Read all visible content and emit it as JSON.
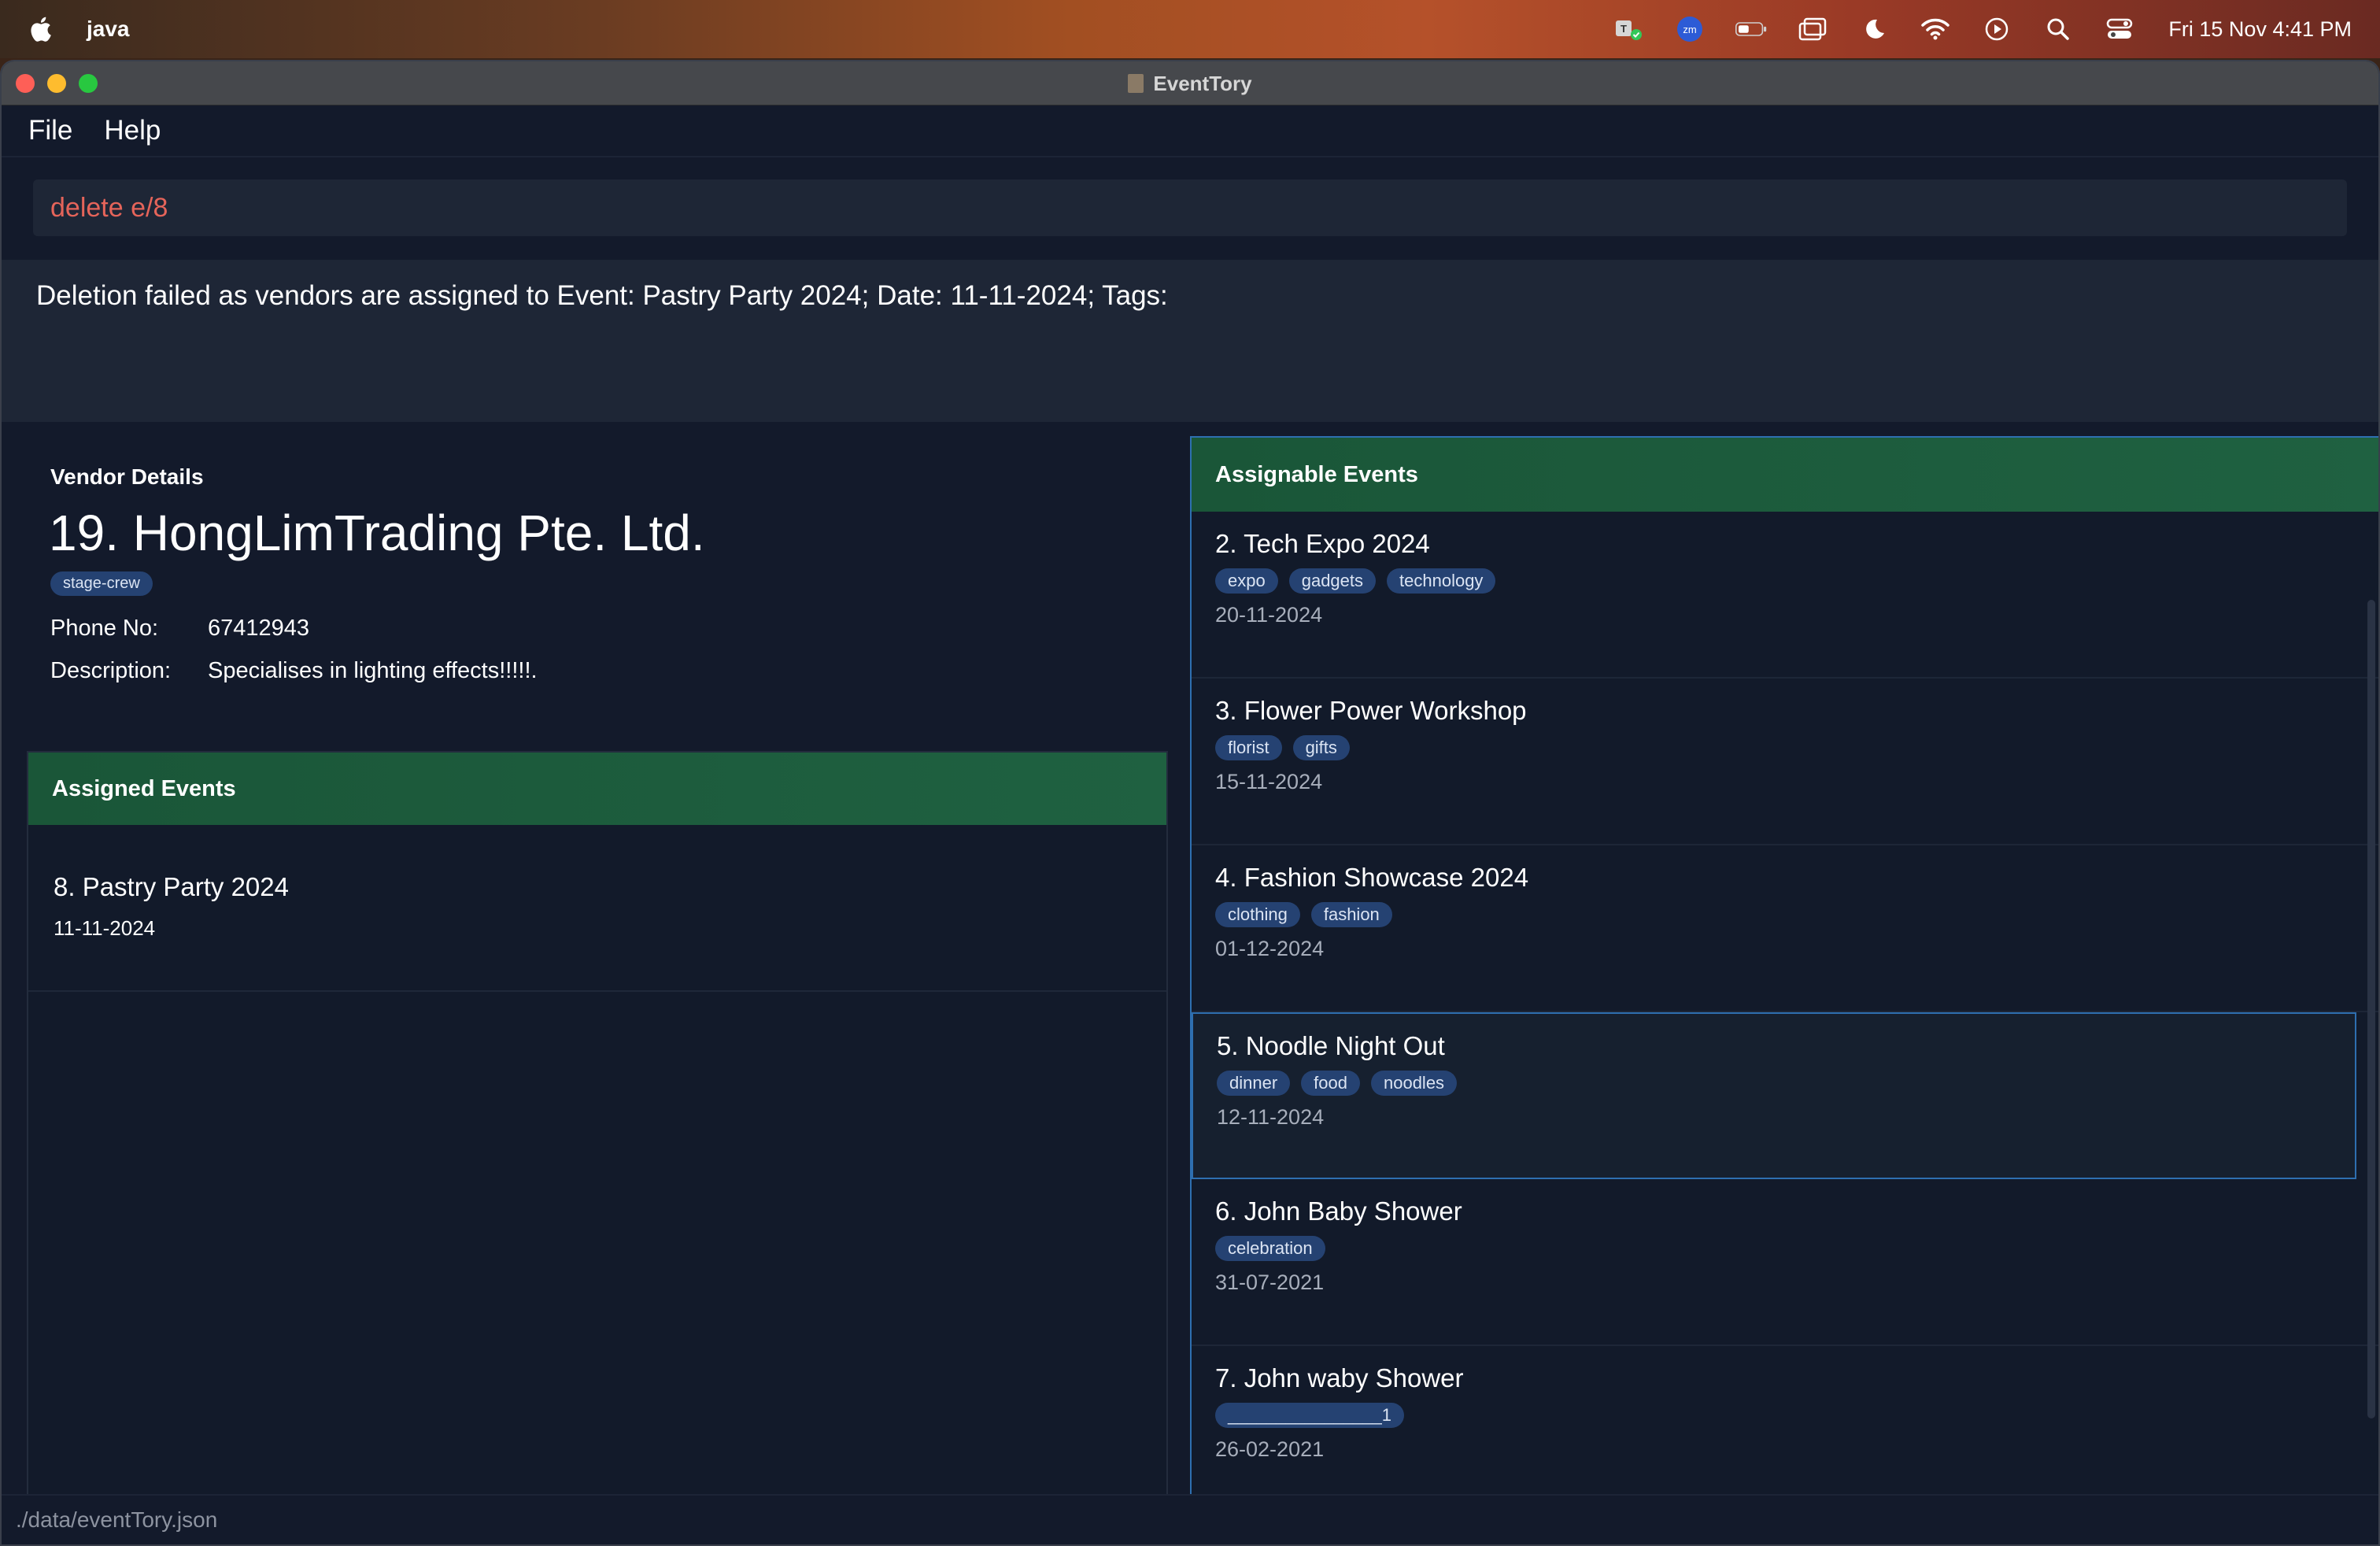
{
  "menubar": {
    "app_name": "java",
    "icons": [
      "apple-icon",
      "teams-icon",
      "zoom-icon",
      "battery-icon",
      "stage-manager-icon",
      "focus-moon-icon",
      "wifi-icon",
      "play-icon",
      "search-icon",
      "control-center-icon"
    ],
    "zoom_label": "zm",
    "clock": "Fri 15 Nov  4:41 PM"
  },
  "window": {
    "title": "EventTory"
  },
  "menu": {
    "file": "File",
    "help": "Help"
  },
  "command": {
    "value": "delete e/8"
  },
  "result": {
    "message": "Deletion failed as vendors are assigned to Event: Pastry Party 2024; Date: 11-11-2024; Tags:"
  },
  "vendor": {
    "section_label": "Vendor Details",
    "name": "19. HongLimTrading Pte. Ltd.",
    "tag": "stage-crew",
    "phone_label": "Phone No:",
    "phone": "67412943",
    "description_label": "Description:",
    "description": "Specialises in lighting effects!!!!!."
  },
  "assigned_events": {
    "header": "Assigned Events",
    "items": [
      {
        "title": "8. Pastry Party 2024",
        "date": "11-11-2024"
      }
    ]
  },
  "assignable_events": {
    "header": "Assignable Events",
    "items": [
      {
        "title": "2. Tech Expo 2024",
        "tags": [
          "expo",
          "gadgets",
          "technology"
        ],
        "date": "20-11-2024"
      },
      {
        "title": "3. Flower Power Workshop",
        "tags": [
          "florist",
          "gifts"
        ],
        "date": "15-11-2024"
      },
      {
        "title": "4. Fashion Showcase 2024",
        "tags": [
          "clothing",
          "fashion"
        ],
        "date": "01-12-2024"
      },
      {
        "title": "5. Noodle Night Out",
        "tags": [
          "dinner",
          "food",
          "noodles"
        ],
        "date": "12-11-2024"
      },
      {
        "title": "6. John Baby Shower",
        "tags": [
          "celebration"
        ],
        "date": "31-07-2021"
      },
      {
        "title": "7. John waby Shower",
        "tags": [
          "________________1"
        ],
        "date": "26-02-2021"
      }
    ]
  },
  "statusbar": {
    "path": "./data/eventTory.json"
  },
  "colors": {
    "accent_green": "#1f6141",
    "selection_blue": "#2e6fb0",
    "command_text": "#e5645a",
    "tag_bg": "#254272"
  }
}
